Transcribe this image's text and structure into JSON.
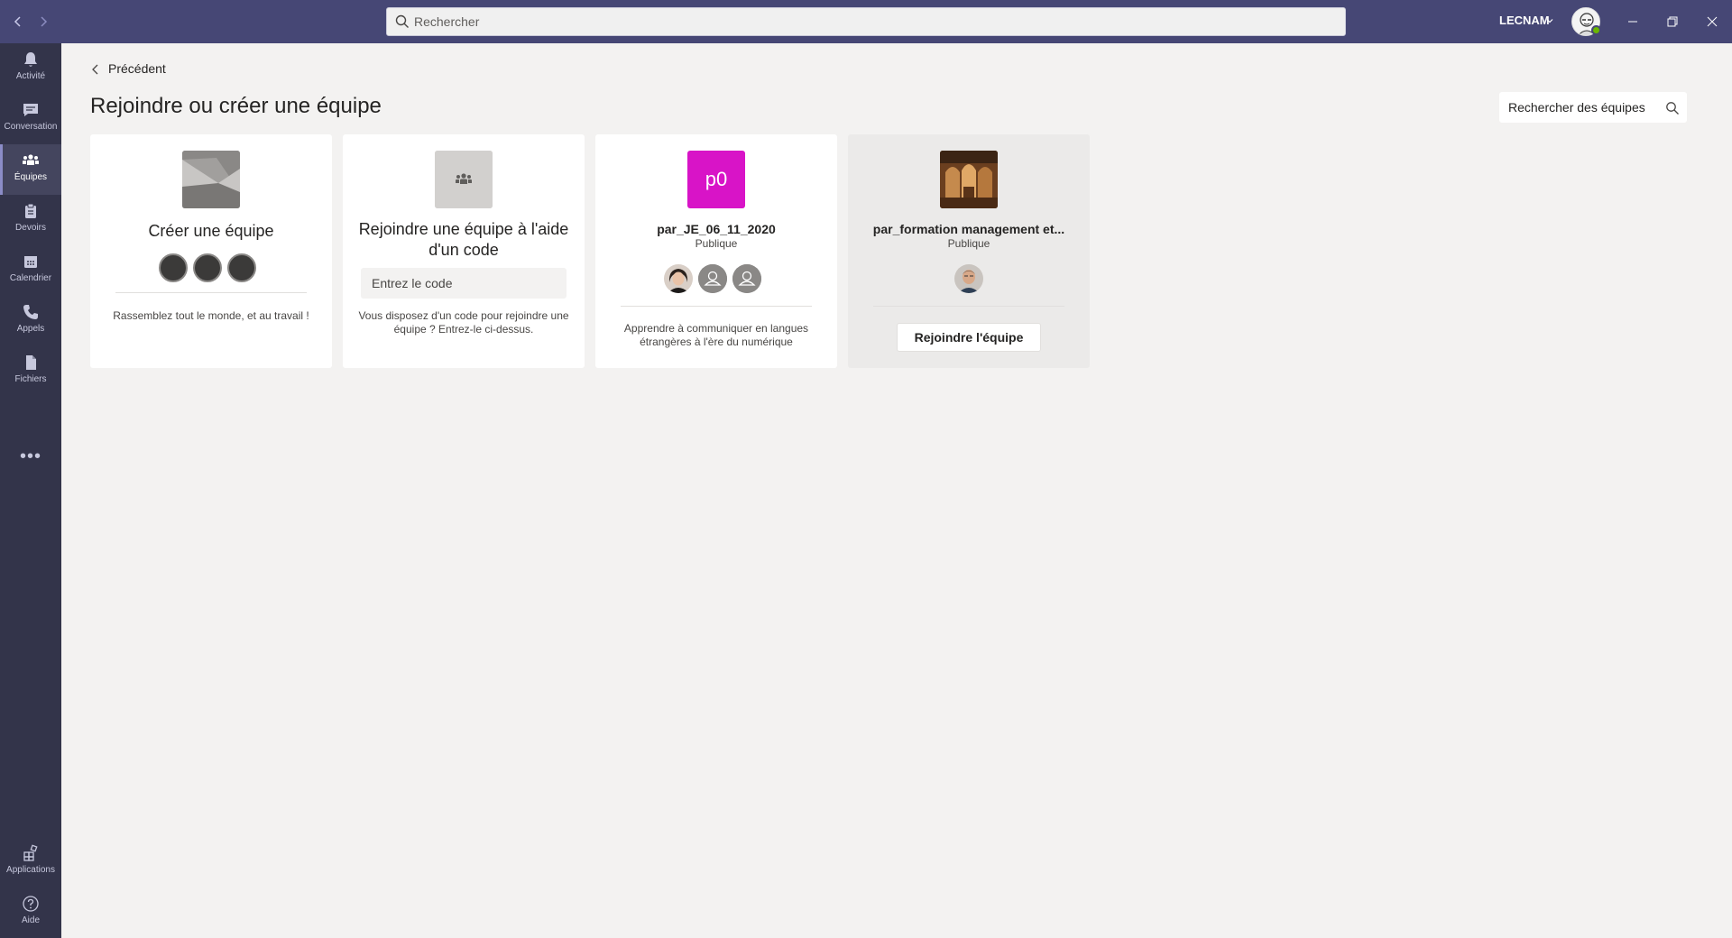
{
  "titlebar": {
    "search_placeholder": "Rechercher",
    "org_name": "LECNAM"
  },
  "rail": {
    "items": [
      {
        "label": "Activité",
        "icon": "bell-icon"
      },
      {
        "label": "Conversation",
        "icon": "chat-icon"
      },
      {
        "label": "Équipes",
        "icon": "teams-icon"
      },
      {
        "label": "Devoirs",
        "icon": "assignments-icon"
      },
      {
        "label": "Calendrier",
        "icon": "calendar-icon"
      },
      {
        "label": "Appels",
        "icon": "phone-icon"
      },
      {
        "label": "Fichiers",
        "icon": "files-icon"
      }
    ],
    "more": "•••",
    "bottom": [
      {
        "label": "Applications",
        "icon": "apps-icon"
      },
      {
        "label": "Aide",
        "icon": "help-icon"
      }
    ],
    "active_index": 2
  },
  "main": {
    "back_label": "Précédent",
    "title": "Rejoindre ou créer une équipe",
    "team_search_placeholder": "Rechercher des équipes"
  },
  "cards": [
    {
      "name": "Créer une équipe",
      "description": "Rassemblez tout le monde, et au travail !"
    },
    {
      "name": "Rejoindre une équipe à l'aide d'un code",
      "code_placeholder": "Entrez le code",
      "description": "Vous disposez d'un code pour rejoindre une équipe ? Entrez-le ci-dessus."
    },
    {
      "tile_text": "p0",
      "tile_color": "#d814c7",
      "name": "par_JE_06_11_2020",
      "visibility": "Publique",
      "description": "Apprendre à communiquer en langues étrangères à l'ère du numérique"
    },
    {
      "name": "par_formation management et...",
      "visibility": "Publique",
      "join_label": "Rejoindre l'équipe"
    }
  ],
  "colors": {
    "titlebar": "#464775",
    "rail": "#33344a",
    "background": "#f3f2f1",
    "presence": "#6bb700"
  }
}
